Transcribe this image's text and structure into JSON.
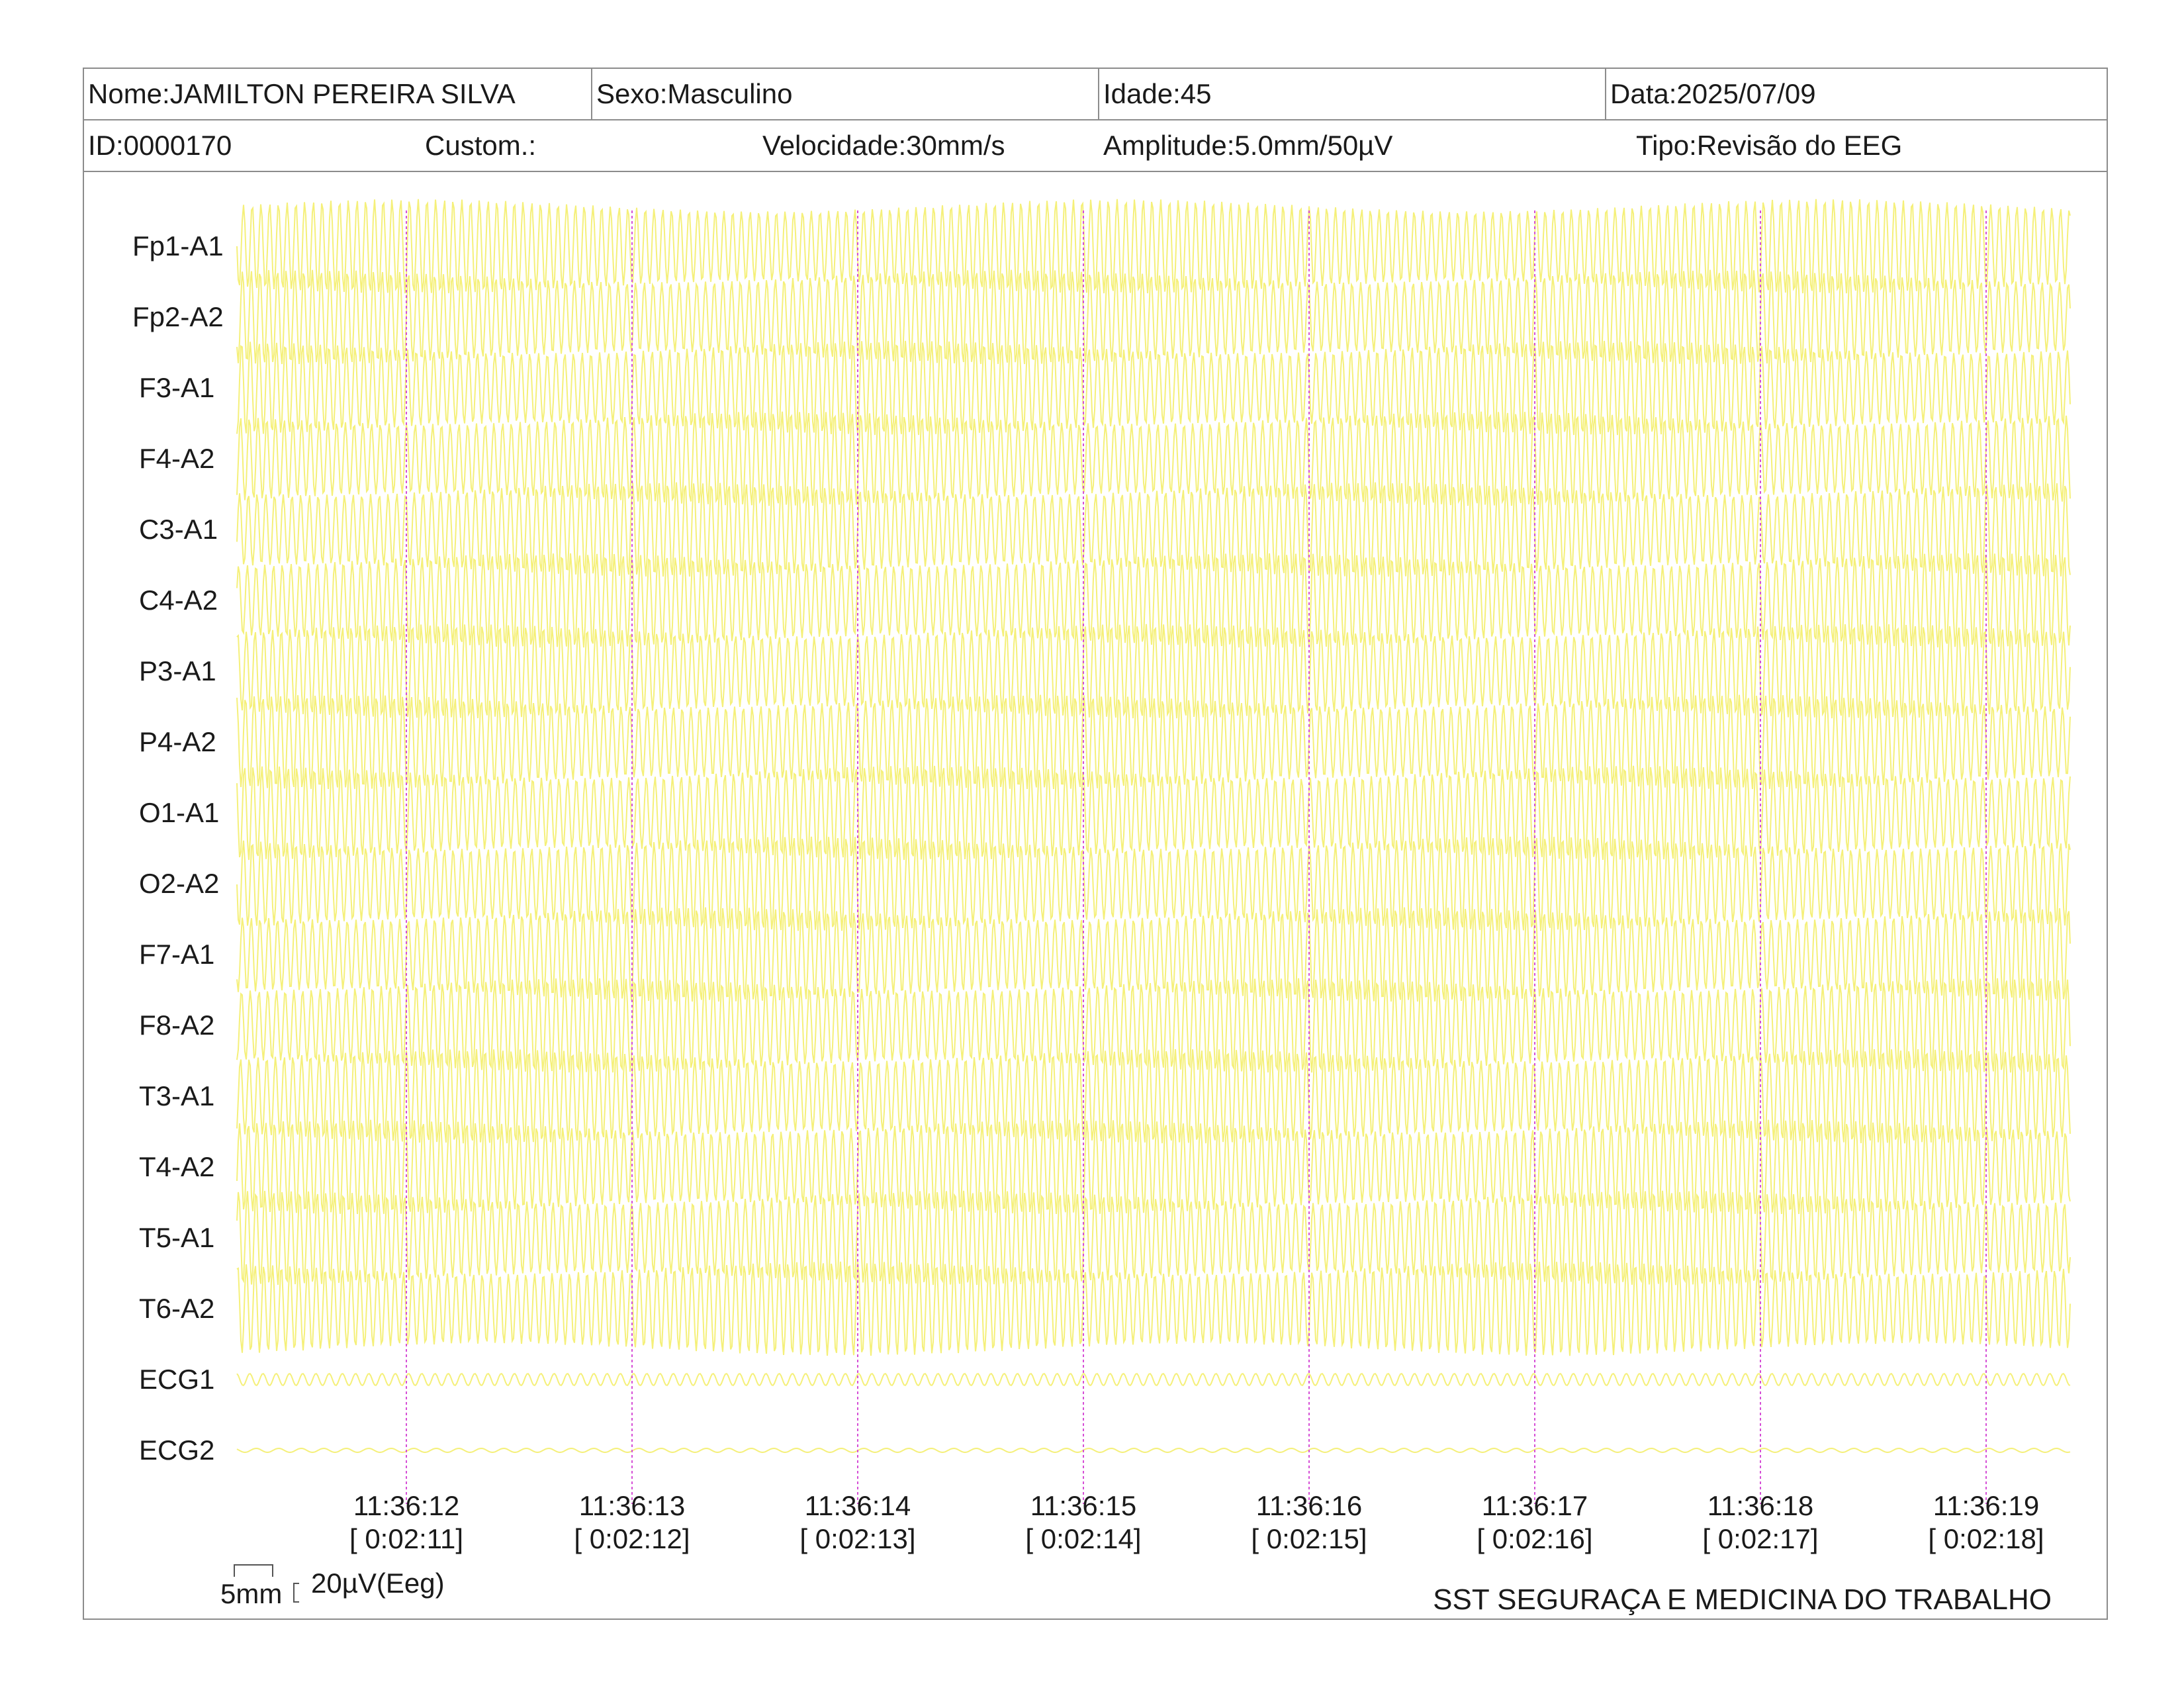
{
  "header": {
    "name": "Nome:JAMILTON PEREIRA SILVA",
    "sex": "Sexo:Masculino",
    "age": "Idade:45",
    "date": "Data:2025/07/09",
    "id": "ID:0000170",
    "custom": "Custom.:",
    "speed": "Velocidade:30mm/s",
    "amplitude": "Amplitude:5.0mm/50µV",
    "type": "Tipo:Revisão do EEG"
  },
  "channels": [
    "Fp1-A1",
    "Fp2-A2",
    "F3-A1",
    "F4-A2",
    "C3-A1",
    "C4-A2",
    "P3-A1",
    "P4-A2",
    "O1-A1",
    "O2-A2",
    "F7-A1",
    "F8-A2",
    "T3-A1",
    "T4-A2",
    "T5-A1",
    "T6-A2",
    "ECG1",
    "ECG2"
  ],
  "time_marks": [
    {
      "clock": "11:36:12",
      "elapsed": "[ 0:02:11]"
    },
    {
      "clock": "11:36:13",
      "elapsed": "[ 0:02:12]"
    },
    {
      "clock": "11:36:14",
      "elapsed": "[ 0:02:13]"
    },
    {
      "clock": "11:36:15",
      "elapsed": "[ 0:02:14]"
    },
    {
      "clock": "11:36:16",
      "elapsed": "[ 0:02:15]"
    },
    {
      "clock": "11:36:17",
      "elapsed": "[ 0:02:16]"
    },
    {
      "clock": "11:36:18",
      "elapsed": "[ 0:02:17]"
    },
    {
      "clock": "11:36:19",
      "elapsed": "[ 0:02:18]"
    }
  ],
  "scale": {
    "time_label": "5mm",
    "amp_label": "20µV(Eeg)"
  },
  "footer": {
    "company": "SST SEGURAÇA E MEDICINA DO TRABALHO"
  },
  "colors": {
    "trace": "#f5f07a",
    "marker": "#d64fd6",
    "border": "#8c8c8c"
  }
}
